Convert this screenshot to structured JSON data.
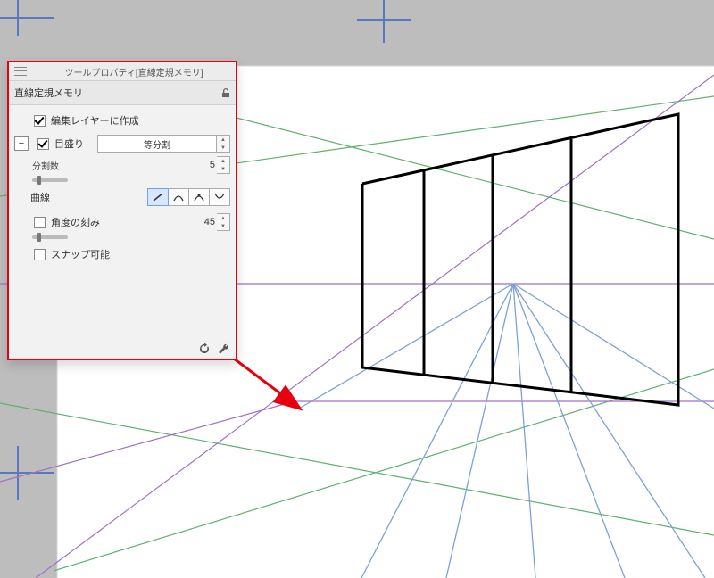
{
  "panel": {
    "title": "ツールプロパティ[直線定規メモリ]",
    "tool_name": "直線定規メモリ",
    "create_on_edit_layer_label": "編集レイヤーに作成",
    "create_on_edit_layer_checked": true,
    "scale_label": "目盛り",
    "scale_checked": true,
    "scale_mode": "等分割",
    "divisions_label": "分割数",
    "divisions_value": "5",
    "curve_label": "曲線",
    "curve_icons": [
      "line-icon",
      "arc-concave-icon",
      "arc-with-handle-icon",
      "arc-convex-icon"
    ],
    "curve_selected_index": 0,
    "angle_step_label": "角度の刻み",
    "angle_step_checked": false,
    "angle_step_value": "45",
    "snap_label": "スナップ可能",
    "snap_checked": false
  },
  "colors": {
    "highlight": "#e8000d",
    "perspective1": "#5fb070",
    "perspective2": "#a070c8",
    "divider": "#7ea0d8",
    "ink": "#000000",
    "canvas": "#ffffff",
    "desk": "#bdbdbd",
    "rule_cross": "#5878c0"
  }
}
